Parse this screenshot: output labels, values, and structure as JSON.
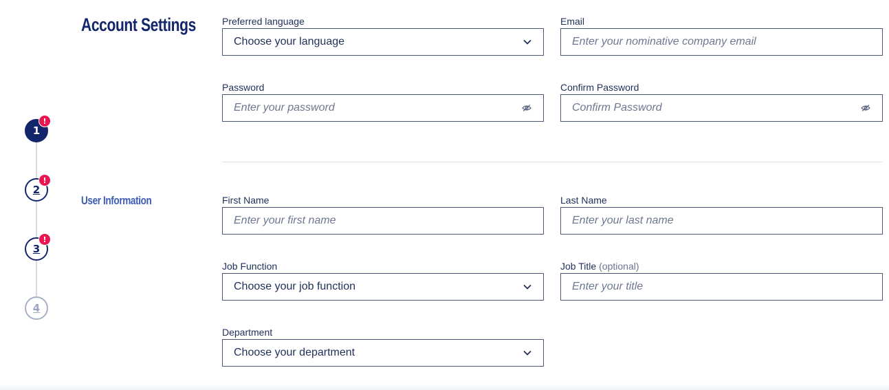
{
  "stepper": {
    "steps": [
      {
        "label": "1",
        "state": "active",
        "alert": "!"
      },
      {
        "label": "2",
        "state": "pending",
        "alert": "!"
      },
      {
        "label": "3",
        "state": "pending",
        "alert": "!"
      },
      {
        "label": "4",
        "state": "disabled"
      }
    ]
  },
  "sections": {
    "account_settings": "Account Settings",
    "user_information": "User Information"
  },
  "account": {
    "language": {
      "label": "Preferred language",
      "value": "Choose your language",
      "icon": "chevron-down-icon"
    },
    "email": {
      "label": "Email",
      "placeholder": "Enter your nominative company email"
    },
    "password": {
      "label": "Password",
      "placeholder": "Enter your password",
      "icon": "eye-off-icon"
    },
    "confirm_password": {
      "label": "Confirm Password",
      "placeholder": "Confirm Password",
      "icon": "eye-off-icon"
    }
  },
  "user": {
    "first_name": {
      "label": "First Name",
      "placeholder": "Enter your first name"
    },
    "last_name": {
      "label": "Last Name",
      "placeholder": "Enter your last name"
    },
    "job_function": {
      "label": "Job Function",
      "value": "Choose your job function",
      "icon": "chevron-down-icon"
    },
    "job_title": {
      "label": "Job Title",
      "optional": "(optional)",
      "placeholder": "Enter your title"
    },
    "department": {
      "label": "Department",
      "value": "Choose your department",
      "icon": "chevron-down-icon"
    }
  },
  "colors": {
    "brand": "#14266b",
    "accent": "#3d5cb6",
    "alert": "#e8154f",
    "border": "#4a5675"
  }
}
